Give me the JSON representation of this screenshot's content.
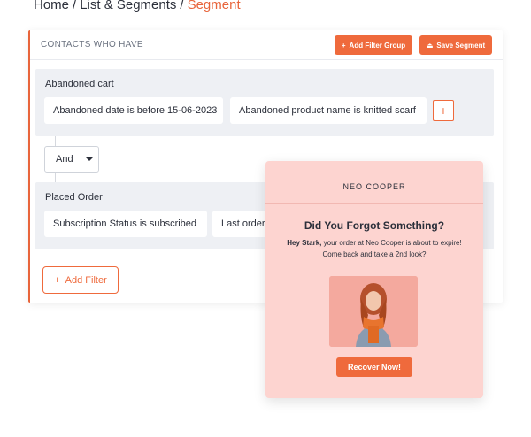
{
  "breadcrumb": {
    "items": [
      "Home",
      "List & Segments"
    ],
    "current": "Segment",
    "separator": "/"
  },
  "segment_card": {
    "title": "CONTACTS WHO HAVE",
    "add_filter_group_label": "Add Filter Group",
    "save_segment_label": "Save Segment",
    "groups": [
      {
        "title": "Abandoned cart",
        "filters": [
          "Abandoned date is before 15-06-2023",
          "Abandoned product name is knitted scarf"
        ]
      },
      {
        "title": "Placed Order",
        "filters": [
          "Subscription Status is subscribed",
          "Last order"
        ]
      }
    ],
    "conjunction": "And",
    "add_filter_label": "Add Filter"
  },
  "popup": {
    "brand": "NEO COOPER",
    "headline": "Did You Forgot Something?",
    "body_greeting": "Hey Stark,",
    "body_text": " your order at Neo Cooper is about to expire! Come back and take a 2nd look?",
    "cta_label": "Recover Now!"
  },
  "colors": {
    "accent": "#ef6a3c",
    "popup_bg": "#fdd4d0",
    "group_bg": "#eef0f4"
  }
}
